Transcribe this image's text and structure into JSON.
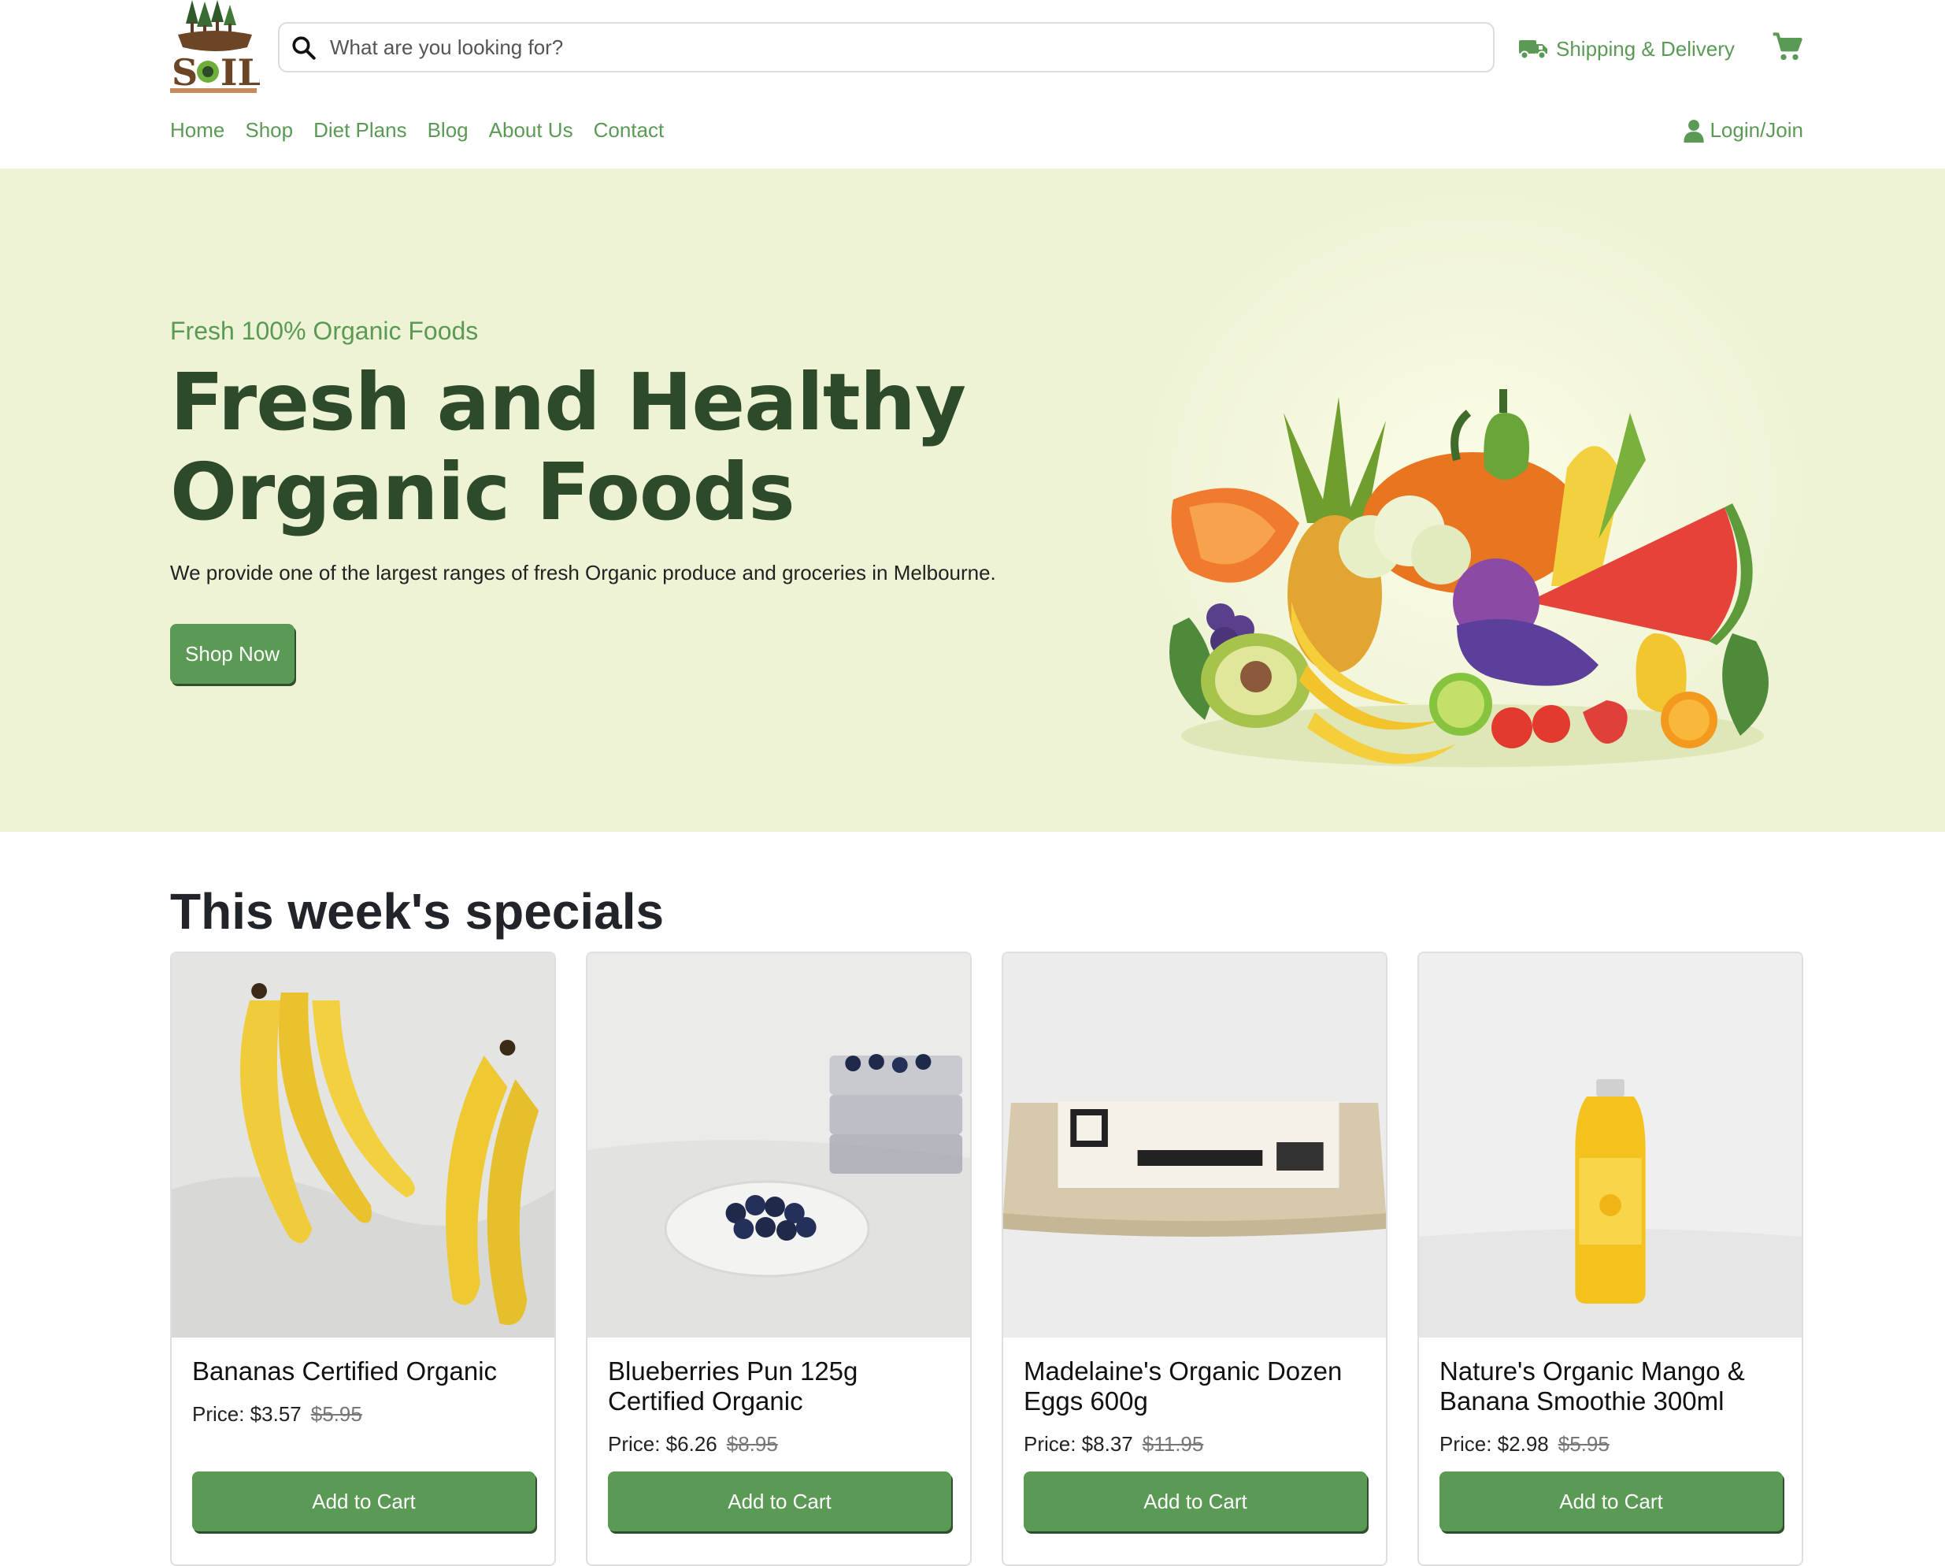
{
  "header": {
    "logo_text": "SOIL",
    "search_placeholder": "What are you looking for?",
    "shipping_label": "Shipping & Delivery",
    "login_label": "Login/Join"
  },
  "nav": {
    "items": [
      "Home",
      "Shop",
      "Diet Plans",
      "Blog",
      "About Us",
      "Contact"
    ]
  },
  "hero": {
    "eyebrow": "Fresh 100% Organic Foods",
    "title_line1": "Fresh and Healthy",
    "title_line2": "Organic Foods",
    "description": "We provide one of the largest ranges of fresh Organic produce and groceries in Melbourne.",
    "cta": "Shop Now"
  },
  "specials": {
    "title": "This week's specials",
    "products": [
      {
        "name": "Bananas Certified Organic",
        "price": "Price: $3.57",
        "old_price": "$5.95",
        "button": "Add to Cart"
      },
      {
        "name": "Blueberries Pun 125g Certified Organic",
        "price": "Price: $6.26",
        "old_price": "$8.95",
        "button": "Add to Cart"
      },
      {
        "name": "Madelaine's Organic Dozen Eggs 600g",
        "price": "Price: $8.37",
        "old_price": "$11.95",
        "button": "Add to Cart"
      },
      {
        "name": "Nature's Organic Mango & Banana Smoothie 300ml",
        "price": "Price: $2.98",
        "old_price": "$5.95",
        "button": "Add to Cart"
      }
    ]
  },
  "colors": {
    "brand_green": "#5a9a55",
    "dark_green": "#2d4a2b",
    "hero_bg": "#eff3d6"
  },
  "icons": [
    "search-icon",
    "truck-icon",
    "cart-icon",
    "user-icon"
  ]
}
